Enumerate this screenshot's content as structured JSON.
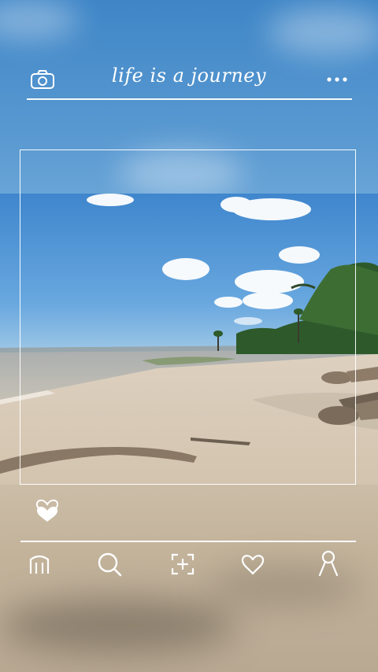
{
  "header": {
    "title": "life is a journey",
    "left_icon": "camera-icon",
    "right_icon": "more-dots-icon"
  },
  "post": {
    "like_icon": "heart-stack-icon"
  },
  "nav": {
    "items": [
      {
        "icon": "home-icon"
      },
      {
        "icon": "search-icon"
      },
      {
        "icon": "add-scan-icon"
      },
      {
        "icon": "heart-icon"
      },
      {
        "icon": "profile-icon"
      }
    ]
  },
  "colors": {
    "accent": "#ffffff",
    "sky": "#4b8fcf",
    "sand": "#d8cbb8"
  }
}
